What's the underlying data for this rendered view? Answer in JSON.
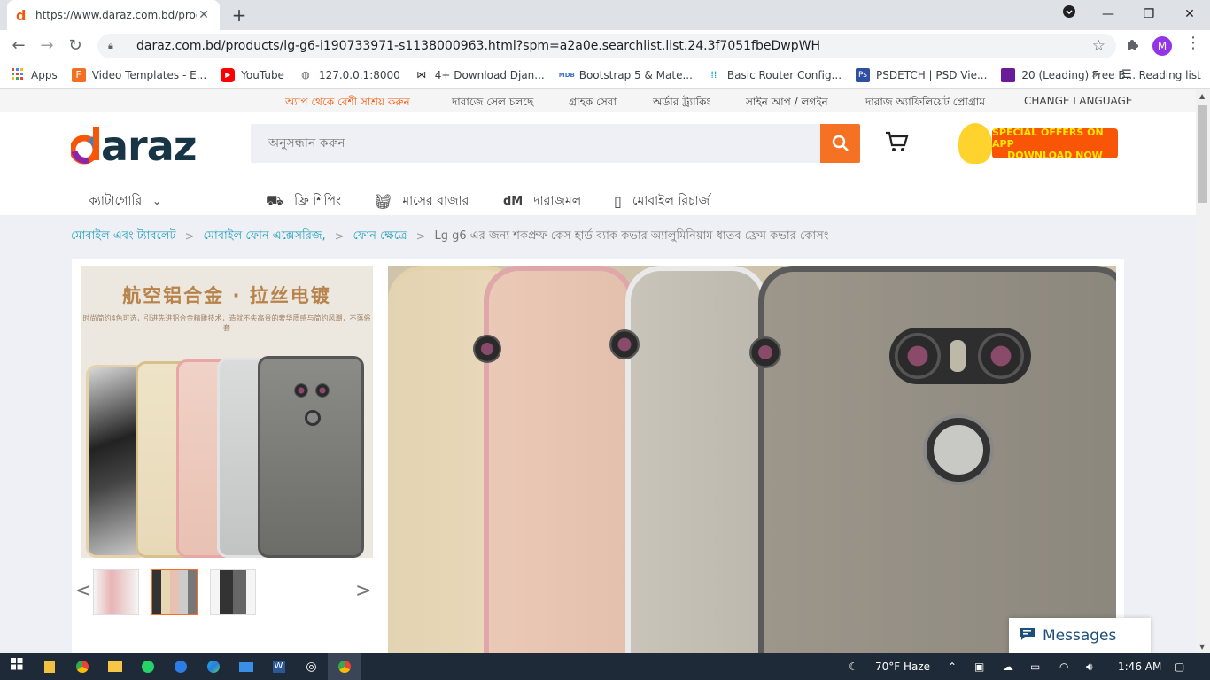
{
  "browser": {
    "tab_favicon": "d",
    "tab_title": "https://www.daraz.com.bd/produ",
    "url": "daraz.com.bd/products/lg-g6-i190733971-s1138000963.html?spm=a2a0e.searchlist.list.24.3f7051fbeDwpWH",
    "profile_initial": "M",
    "bookmarks": [
      {
        "label": "Apps",
        "icon": "apps-grid-icon"
      },
      {
        "label": "Video Templates - E...",
        "icon": "video-templates-icon"
      },
      {
        "label": "YouTube",
        "icon": "youtube-icon"
      },
      {
        "label": "127.0.0.1:8000",
        "icon": "globe-icon"
      },
      {
        "label": "4+ Download Djan...",
        "icon": "bowtie-icon"
      },
      {
        "label": "Bootstrap 5 & Mate...",
        "icon": "mdb-icon"
      },
      {
        "label": "Basic Router Config...",
        "icon": "cisco-icon"
      },
      {
        "label": "PSDETCH | PSD Vie...",
        "icon": "photoshop-icon"
      },
      {
        "label": "20 (Leading) Free B...",
        "icon": "colorlib-icon"
      }
    ],
    "reading_list": "Reading list"
  },
  "topbar": {
    "app_offer": "অ্যাপ থেকে বেশী সাশ্রয় করুন",
    "sell": "দারাজে সেল চলছে",
    "customer_care": "গ্রাহক সেবা",
    "order_tracking": "অর্ডার ট্র্যাকিং",
    "signup_login": "সাইন আপ / লগইন",
    "affiliate": "দারাজ অ্যাফিলিয়েট প্রোগ্রাম",
    "change_language": "CHANGE LANGUAGE"
  },
  "header": {
    "logo_text": "daraz",
    "search_placeholder": "অনুসন্ধান করুন",
    "promo_line1": "SPECIAL OFFERS ON APP",
    "promo_line2": "DOWNLOAD NOW"
  },
  "catbar": {
    "categories": "ক্যাটাগোরি",
    "free_shipping": "ফ্রি শিপিং",
    "monthly_bazar": "মাসের বাজার",
    "daraz_mall": "দারাজমল",
    "mobile_recharge": "মোবাইল রিচার্জ"
  },
  "breadcrumb": {
    "items": [
      "মোবাইল এবং ট্যাবলেট",
      "মোবাইল ফোন এক্সেসরিজ,",
      "ফোন ক্ষেত্রে"
    ],
    "current": "Lg g6 এর জন্য শকপ্রুফ কেস হার্ড ব্যাক কভার অ্যালুমিনিয়াম ধাতব ফ্রেম কভার কোসং"
  },
  "gallery": {
    "title": "航空铝合金 · 拉丝电镀",
    "subtitle": "时尚简约4色可选，引进先进铝合金精雕技术，造就不失高贵的奢华质感与简约风潮，不落俗套",
    "thumbnail_count": 3,
    "active_thumbnail": 2
  },
  "messages": {
    "label": "Messages"
  },
  "taskbar": {
    "weather": "70°F  Haze",
    "time": "1:46 AM"
  }
}
